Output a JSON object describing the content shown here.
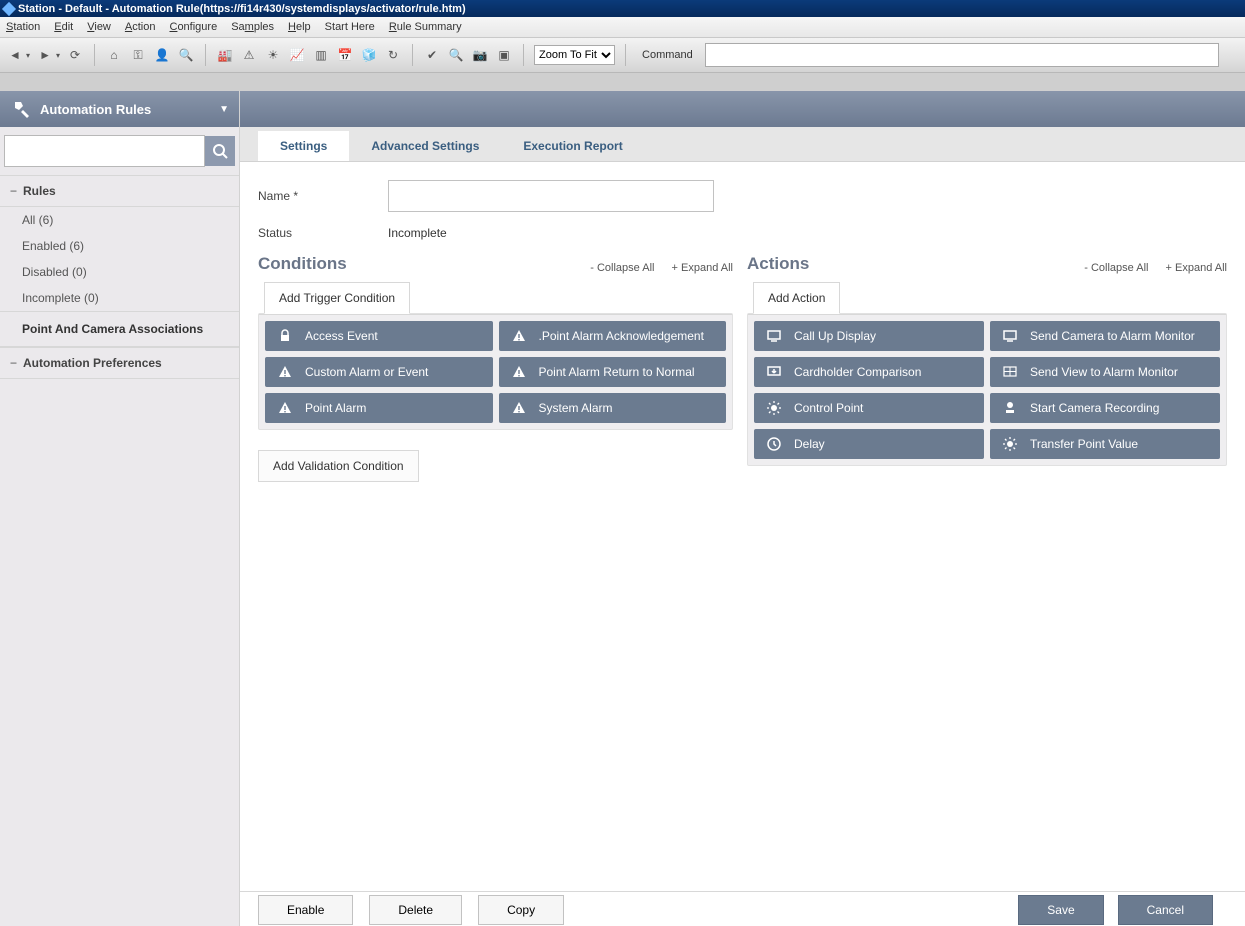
{
  "window": {
    "title": "Station - Default - Automation Rule(https://fi14r430/systemdisplays/activator/rule.htm)"
  },
  "menu": [
    "Station",
    "Edit",
    "View",
    "Action",
    "Configure",
    "Samples",
    "Help",
    "Start Here",
    "Rule Summary"
  ],
  "toolbar": {
    "zoom": "Zoom To Fit",
    "command_label": "Command"
  },
  "sidebar": {
    "title": "Automation Rules",
    "search_placeholder": "",
    "rules_label": "Rules",
    "rules_items": [
      {
        "label": "All (6)"
      },
      {
        "label": "Enabled (6)"
      },
      {
        "label": "Disabled (0)"
      },
      {
        "label": "Incomplete (0)"
      }
    ],
    "assoc_label": "Point And Camera Associations",
    "prefs_label": "Automation Preferences"
  },
  "tabs": [
    {
      "label": "Settings",
      "active": true
    },
    {
      "label": "Advanced Settings",
      "active": false
    },
    {
      "label": "Execution Report",
      "active": false
    }
  ],
  "form": {
    "name_label": "Name *",
    "name_value": "",
    "status_label": "Status",
    "status_value": "Incomplete"
  },
  "conditions": {
    "title": "Conditions",
    "collapse": "- Collapse All",
    "expand": "+ Expand All",
    "add_trigger": "Add Trigger Condition",
    "items": [
      {
        "icon": "lock",
        "label": "Access Event"
      },
      {
        "icon": "warn",
        "label": ".Point Alarm Acknowledgement"
      },
      {
        "icon": "warn",
        "label": "Custom Alarm or Event"
      },
      {
        "icon": "warn",
        "label": "Point Alarm Return to Normal"
      },
      {
        "icon": "warn",
        "label": "Point Alarm"
      },
      {
        "icon": "warn",
        "label": "System Alarm"
      }
    ],
    "add_validation": "Add Validation Condition"
  },
  "actions": {
    "title": "Actions",
    "collapse": "- Collapse All",
    "expand": "+ Expand All",
    "add_action": "Add Action",
    "items": [
      {
        "icon": "display",
        "label": "Call Up Display"
      },
      {
        "icon": "display",
        "label": "Send Camera to Alarm Monitor"
      },
      {
        "icon": "download",
        "label": "Cardholder Comparison"
      },
      {
        "icon": "grid",
        "label": "Send View to Alarm Monitor"
      },
      {
        "icon": "sun",
        "label": "Control Point"
      },
      {
        "icon": "record",
        "label": "Start Camera Recording"
      },
      {
        "icon": "clock",
        "label": "Delay"
      },
      {
        "icon": "sun",
        "label": "Transfer Point Value"
      }
    ]
  },
  "footer": {
    "enable": "Enable",
    "delete": "Delete",
    "copy": "Copy",
    "save": "Save",
    "cancel": "Cancel"
  }
}
